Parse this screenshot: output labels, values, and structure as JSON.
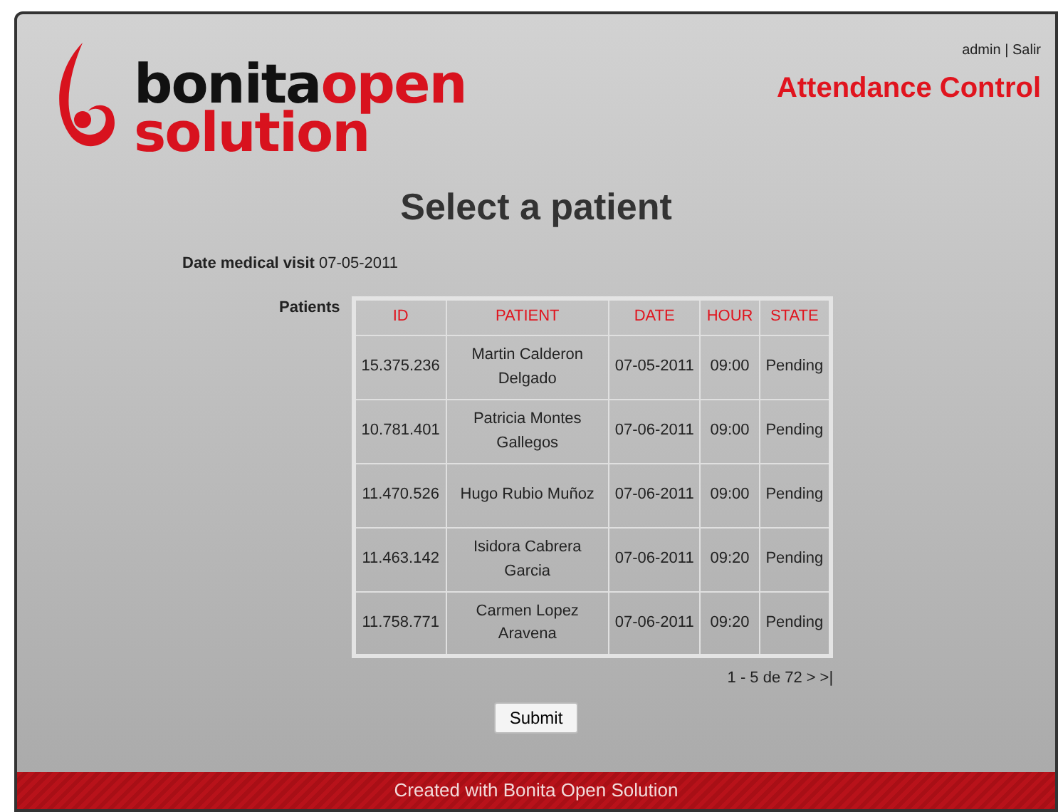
{
  "logo": {
    "part_1": "bonita",
    "part_2": "open",
    "part_3": "solution"
  },
  "user_links": {
    "user": "admin",
    "separator": "|",
    "logout": "Salir"
  },
  "app_title": "Attendance Control",
  "heading": "Select a patient",
  "visit": {
    "label": "Date medical visit",
    "value": "07-05-2011"
  },
  "patients": {
    "label": "Patients",
    "columns": [
      "ID",
      "PATIENT",
      "DATE",
      "HOUR",
      "STATE"
    ],
    "rows": [
      [
        "15.375.236",
        "Martin Calderon Delgado",
        "07-05-2011",
        "09:00",
        "Pending"
      ],
      [
        "10.781.401",
        "Patricia Montes Gallegos",
        "07-06-2011",
        "09:00",
        "Pending"
      ],
      [
        "11.470.526",
        "Hugo Rubio Muñoz",
        "07-06-2011",
        "09:00",
        "Pending"
      ],
      [
        "11.463.142",
        "Isidora Cabrera Garcia",
        "07-06-2011",
        "09:20",
        "Pending"
      ],
      [
        "11.758.771",
        "Carmen Lopez Aravena",
        "07-06-2011",
        "09:20",
        "Pending"
      ]
    ],
    "pagination": {
      "range": "1 - 5 de 72",
      "next": ">",
      "last": ">|"
    }
  },
  "submit": "Submit",
  "footer": "Created with Bonita Open Solution"
}
